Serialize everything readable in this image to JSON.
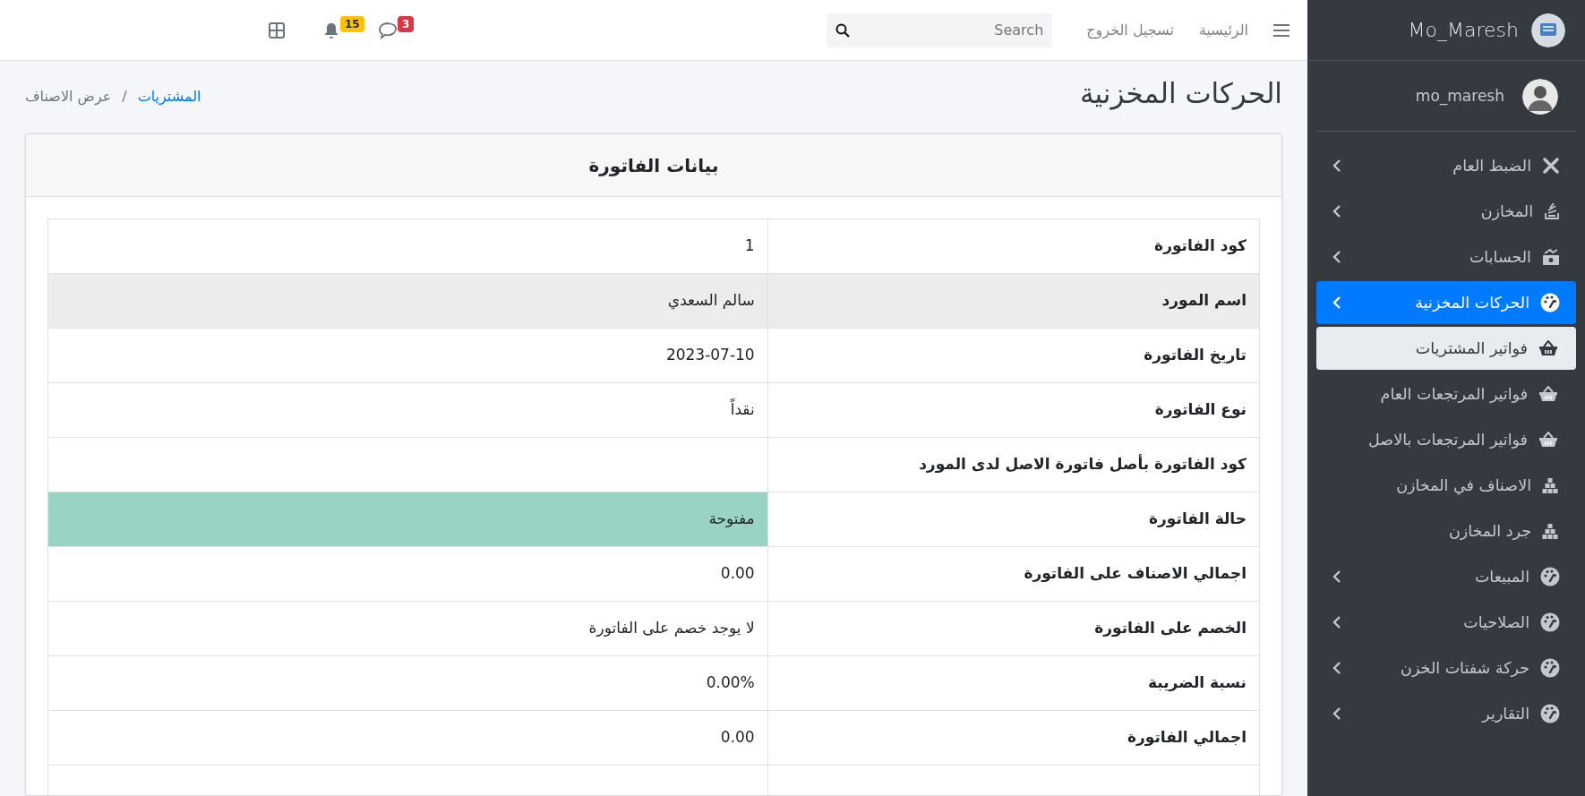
{
  "navbar": {
    "links": [
      "الرئيسية",
      "تسجيل الخروج"
    ],
    "search": {
      "placeholder": "Search"
    },
    "badges": [
      {
        "text": "3",
        "color": "#dc3545"
      },
      {
        "text": "15",
        "color": "#ffc107"
      }
    ]
  },
  "sidebar": {
    "brand": "Mo_Maresh",
    "user": "mo_maresh",
    "items": [
      {
        "label": "الضبط العام",
        "selected": false
      },
      {
        "label": "المخازن",
        "selected": false
      },
      {
        "label": "الحسابات",
        "selected": false
      },
      {
        "label": "الحركات المخزنية",
        "selected": true,
        "children": [
          {
            "label": "فواتير المشتريات",
            "selected": true
          },
          {
            "label": "فواتير المرتجعات العام",
            "selected": false
          },
          {
            "label": "فواتير المرتجعات بالاصل",
            "selected": false
          },
          {
            "label": "الاصناف في المخازن",
            "selected": false
          },
          {
            "label": "جرد المخازن",
            "selected": false
          }
        ]
      },
      {
        "label": "المبيعات",
        "selected": false
      },
      {
        "label": "الصلاحيات",
        "selected": false
      },
      {
        "label": "حركة شفتات الخزن",
        "selected": false
      },
      {
        "label": "التقارير",
        "selected": false
      }
    ]
  },
  "page": {
    "title": "الحركات المخزنية",
    "breadcrumb": {
      "separator": "/",
      "items": [
        {
          "label": "المشتريات",
          "selected": false
        },
        {
          "label": "عرض الاصناف",
          "selected": true
        }
      ]
    }
  },
  "card": {
    "title": "بيانات الفاتورة",
    "rows": [
      {
        "label": "كود الفاتورة",
        "value": "1",
        "selected": false
      },
      {
        "label": "اسم المورد",
        "value": "سالم السعدي",
        "selected": true
      },
      {
        "label": "تاريخ الفاتورة",
        "value": "2023-07-10",
        "selected": false
      },
      {
        "label": "نوع الفاتورة",
        "value": "نقداً",
        "selected": false
      },
      {
        "label": "كود الفاتورة بأصل فاتورة الاصل لدى المورد",
        "selected": false
      },
      {
        "label": "حالة الفاتورة",
        "value": "مفتوحة",
        "selected": false,
        "color": "#99d3c3"
      },
      {
        "label": "اجمالي الاصناف على الفاتورة",
        "value": "0.00",
        "selected": false
      },
      {
        "label": "الخصم على الفاتورة",
        "value": "لا يوجد خصم على الفاتورة",
        "selected": false
      },
      {
        "label": "نسبة الضريبة",
        "value": "0.00%",
        "selected": false
      },
      {
        "label": "اجمالي الفاتورة",
        "value": "0.00",
        "selected": false
      }
    ]
  }
}
